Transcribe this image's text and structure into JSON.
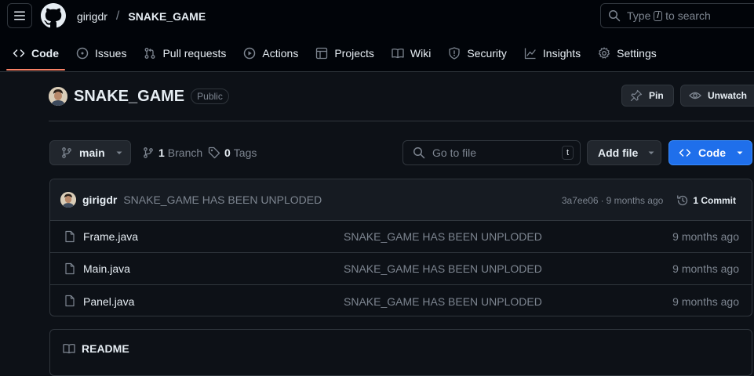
{
  "header": {
    "owner": "girigdr",
    "separator": "/",
    "repo": "SNAKE_GAME",
    "search": {
      "prefix": "Type",
      "key": "/",
      "suffix": "to search"
    }
  },
  "tabs": [
    {
      "label": "Code",
      "icon": "code-icon",
      "active": true
    },
    {
      "label": "Issues",
      "icon": "issue-icon"
    },
    {
      "label": "Pull requests",
      "icon": "pull-request-icon"
    },
    {
      "label": "Actions",
      "icon": "play-icon"
    },
    {
      "label": "Projects",
      "icon": "table-icon"
    },
    {
      "label": "Wiki",
      "icon": "book-icon"
    },
    {
      "label": "Security",
      "icon": "shield-icon"
    },
    {
      "label": "Insights",
      "icon": "graph-icon"
    },
    {
      "label": "Settings",
      "icon": "gear-icon"
    }
  ],
  "repo_header": {
    "name": "SNAKE_GAME",
    "visibility": "Public",
    "pin_label": "Pin",
    "watch_label": "Unwatch"
  },
  "toolbar": {
    "branch": "main",
    "branch_count": "1",
    "branch_label": "Branch",
    "tag_count": "0",
    "tag_label": "Tags",
    "go_to_file_placeholder": "Go to file",
    "go_to_file_key": "t",
    "add_file_label": "Add file",
    "code_label": "Code"
  },
  "latest_commit": {
    "author": "girigdr",
    "message": "SNAKE_GAME HAS BEEN UNPLODED",
    "sha": "3a7ee06",
    "dot": "·",
    "age": "9 months ago",
    "commit_count": "1 Commit"
  },
  "files": [
    {
      "name": "Frame.java",
      "message": "SNAKE_GAME HAS BEEN UNPLODED",
      "age": "9 months ago"
    },
    {
      "name": "Main.java",
      "message": "SNAKE_GAME HAS BEEN UNPLODED",
      "age": "9 months ago"
    },
    {
      "name": "Panel.java",
      "message": "SNAKE_GAME HAS BEEN UNPLODED",
      "age": "9 months ago"
    }
  ],
  "readme": {
    "label": "README"
  },
  "colors": {
    "background": "#0d1117",
    "header_bg": "#010409",
    "border": "#30363d",
    "muted": "#7d8590",
    "accent_underline": "#f78166",
    "primary_button": "#1f6feb"
  }
}
